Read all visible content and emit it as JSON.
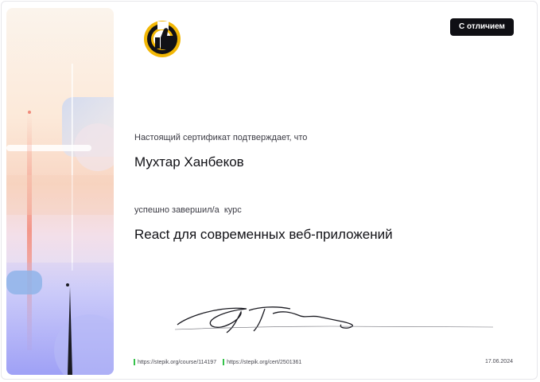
{
  "badge": {
    "label": "С отличием"
  },
  "certificate": {
    "intro_text": "Настоящий сертификат подтверждает, что",
    "recipient_name": "Мухтар Ханбеков",
    "completed_text": "успешно завершил/а  курс",
    "course_title": "React для современных веб-приложений"
  },
  "footer": {
    "course_link": "https://stepik.org/course/114197",
    "cert_link": "https://stepik.org/cert/2501361",
    "date": "17.06.2024"
  },
  "colors": {
    "badge_bg": "#0f0f14",
    "link_mark": "#35c24a",
    "logo_ring": "#f2b705"
  },
  "icons": {
    "logo": "thumbs-up-logo-icon"
  }
}
